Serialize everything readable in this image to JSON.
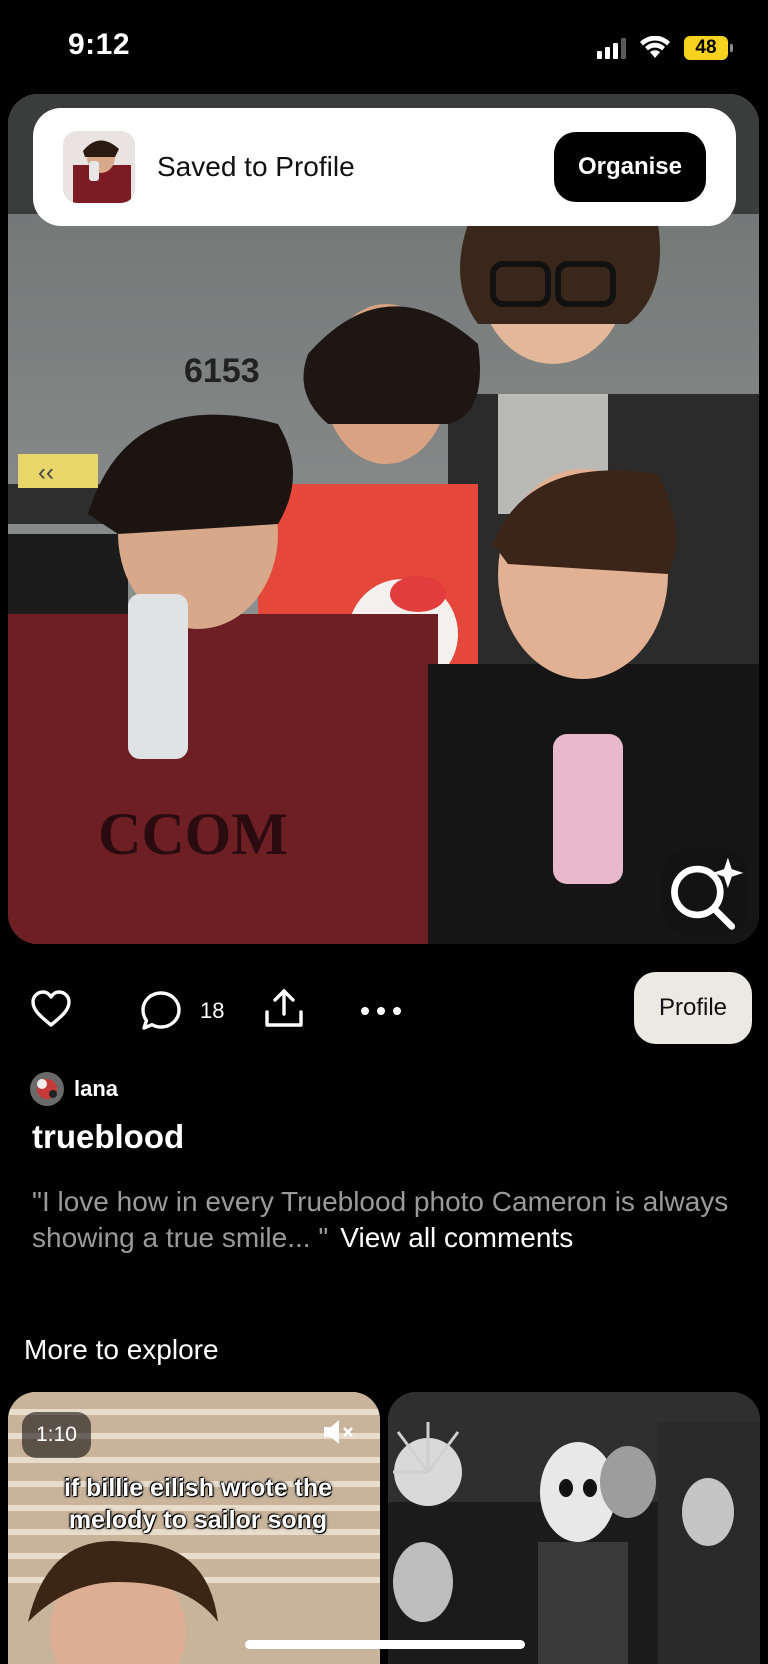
{
  "status_bar": {
    "time": "9:12",
    "battery": "48"
  },
  "toast": {
    "message": "Saved to Profile",
    "action_label": "Organise"
  },
  "pin": {
    "image_sign_number": "6153",
    "comment_count": "18",
    "profile_button_label": "Profile",
    "author_name": "lana",
    "title": "trueblood",
    "comment_preview": "\"I love how in every Trueblood photo Cameron is always showing a true smile... \"",
    "view_all_label": "View all comments"
  },
  "explore": {
    "heading": "More to explore",
    "cards": [
      {
        "duration": "1:10",
        "caption": "if billie eilish wrote the melody to sailor song"
      },
      {}
    ]
  },
  "icons": {
    "like": "heart-outline-icon",
    "comment": "comment-bubble-icon",
    "share": "share-upload-icon",
    "more": "ellipsis-icon",
    "visual_search": "lens-sparkle-icon",
    "mute": "speaker-muted-icon"
  }
}
